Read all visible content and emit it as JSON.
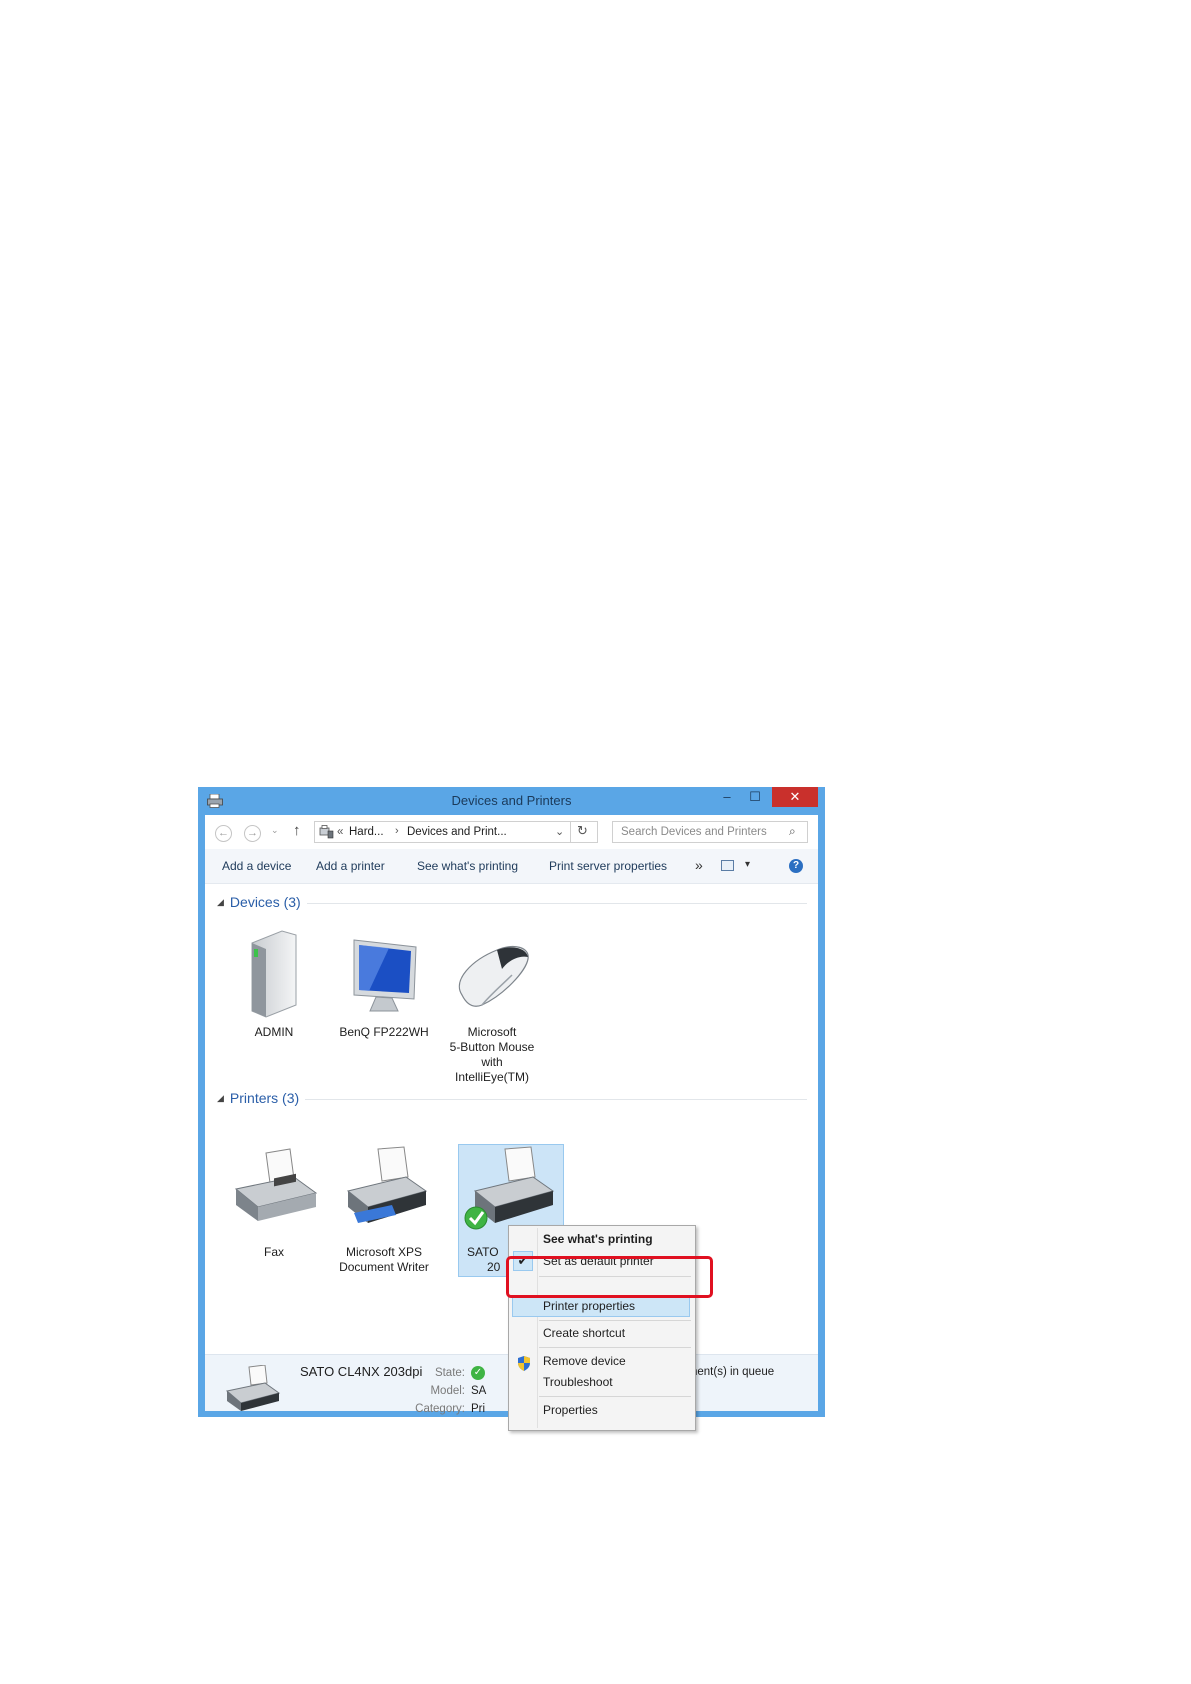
{
  "window": {
    "title": "Devices and Printers",
    "controls": {
      "minimize": "–",
      "maximize": "☐",
      "close": "✕"
    }
  },
  "address_bar": {
    "prefix": "«",
    "segment1": "Hard...",
    "separator": "›",
    "segment2": "Devices and Print...",
    "dropdown": "⌄",
    "refresh": "↻",
    "search_placeholder": "Search Devices and Printers",
    "search_icon": "⌕"
  },
  "navigation": {
    "back": "←",
    "forward": "→",
    "recent": "⌄",
    "up": "↑"
  },
  "commands": {
    "add_device": "Add a device",
    "add_printer": "Add a printer",
    "see_printing": "See what's printing",
    "print_server": "Print server properties",
    "more": "»",
    "view_dropdown": "▾",
    "help": "?"
  },
  "groups": {
    "devices": {
      "header": "Devices (3)",
      "items": [
        {
          "label": "ADMIN",
          "icon": "computer-tower-icon"
        },
        {
          "label": "BenQ FP222WH",
          "icon": "monitor-icon"
        },
        {
          "label_lines": [
            "Microsoft",
            "5-Button Mouse",
            "with",
            "IntelliEye(TM)"
          ],
          "icon": "mouse-icon"
        }
      ]
    },
    "printers": {
      "header": "Printers (3)",
      "items": [
        {
          "label": "Fax",
          "icon": "fax-icon"
        },
        {
          "label_lines": [
            "Microsoft XPS",
            "Document Writer"
          ],
          "icon": "printer-icon"
        },
        {
          "label_lines": [
            "SATO",
            "20"
          ],
          "icon": "default-printer-icon",
          "selected": true
        }
      ]
    }
  },
  "details_pane": {
    "name": "SATO CL4NX 203dpi",
    "state_label": "State:",
    "model_label": "Model:",
    "model_value": "SA",
    "category_label": "Category:",
    "category_value": "Pri",
    "queue_text": "nent(s) in queue"
  },
  "context_menu": {
    "items": [
      {
        "label": "See what's printing",
        "bold": true
      },
      {
        "label": "Set as default printer",
        "checked": true
      },
      {
        "label": "Printer properties",
        "highlighted": true
      },
      {
        "label": "Create shortcut"
      },
      {
        "label": "Remove device",
        "icon": "uac-shield-icon"
      },
      {
        "label": "Troubleshoot"
      },
      {
        "label": "Properties"
      }
    ],
    "check_glyph": "✔"
  },
  "colors": {
    "window_frame": "#5aa6e6",
    "close_button": "#c9302c",
    "group_header": "#2a5ea8",
    "highlight_box": "#e01020",
    "selection": "#cce4f7"
  }
}
